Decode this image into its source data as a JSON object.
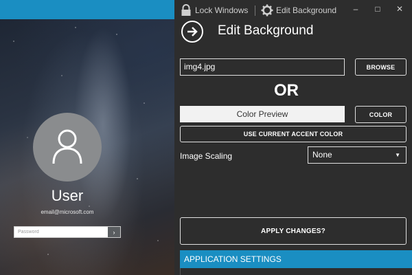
{
  "preview": {
    "user_name": "User",
    "user_email": "email@microsoft.com",
    "password_placeholder": "Password",
    "submit_glyph": "›"
  },
  "titlebar": {
    "lock_label": "Lock Windows",
    "edit_bg_label": "Edit Background",
    "minimize_glyph": "–",
    "maximize_glyph": "□",
    "close_glyph": "✕"
  },
  "header": {
    "title": "Edit Background"
  },
  "background": {
    "file_value": "img4.jpg",
    "browse_label": "BROWSE",
    "or_label": "OR",
    "color_preview_label": "Color Preview",
    "color_label": "COLOR",
    "accent_label": "USE CURRENT ACCENT COLOR",
    "scaling_label": "Image Scaling",
    "scaling_value": "None",
    "caret_glyph": "▼",
    "apply_label": "APPLY CHANGES?"
  },
  "settings": {
    "section_label": "APPLICATION SETTINGS"
  },
  "colors": {
    "accent": "#1a8ec2",
    "panel_bg": "#2d2d2d",
    "text": "#ffffff"
  }
}
